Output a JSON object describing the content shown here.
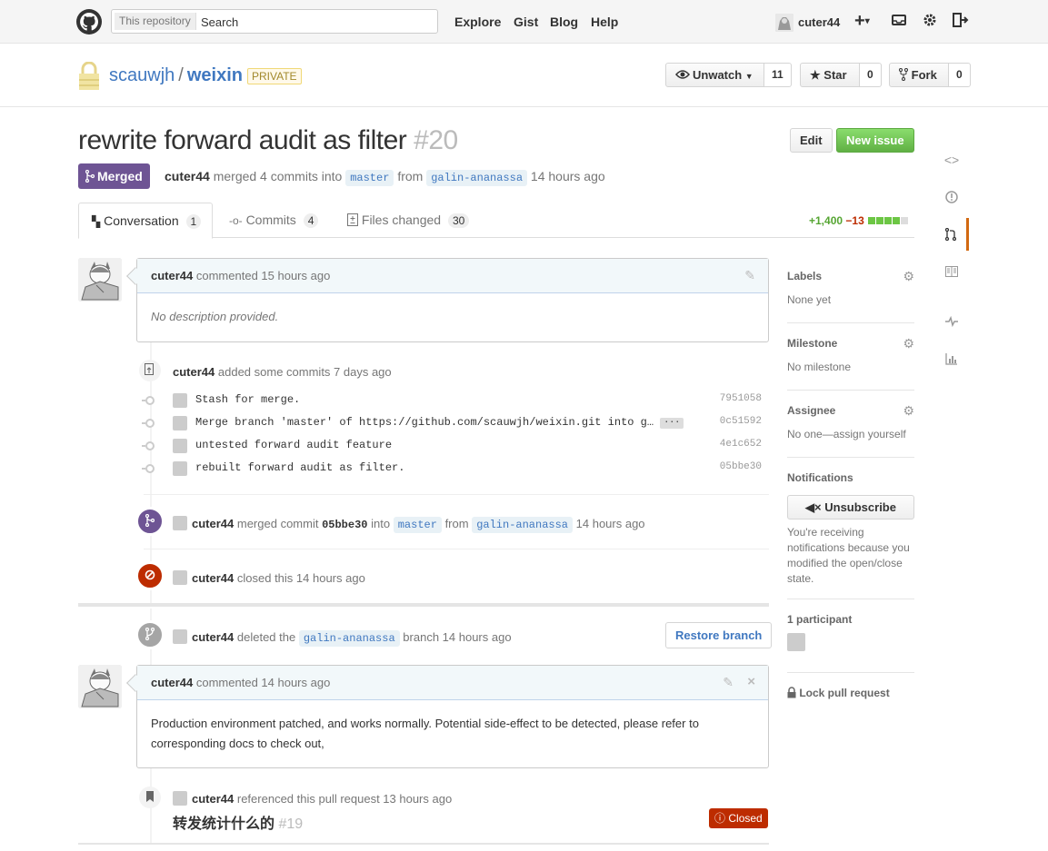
{
  "header": {
    "search_scope": "This repository",
    "search_placeholder": "Search",
    "nav": [
      "Explore",
      "Gist",
      "Blog",
      "Help"
    ],
    "username": "cuter44"
  },
  "repo": {
    "owner": "scauwjh",
    "name": "weixin",
    "visibility": "PRIVATE",
    "unwatch_label": "Unwatch",
    "watch_count": "11",
    "star_label": "Star",
    "star_count": "0",
    "fork_label": "Fork",
    "fork_count": "0"
  },
  "pr": {
    "title": "rewrite forward audit as filter",
    "number": "#20",
    "edit_label": "Edit",
    "new_issue_label": "New issue",
    "state": "Merged",
    "author": "cuter44",
    "merged_text": "merged 4 commits into",
    "base": "master",
    "from_text": "from",
    "head": "galin-ananassa",
    "time": "14 hours ago"
  },
  "tabs": [
    {
      "label": "Conversation",
      "count": "1"
    },
    {
      "label": "Commits",
      "count": "4"
    },
    {
      "label": "Files changed",
      "count": "30"
    }
  ],
  "diffstat": {
    "additions": "+1,400",
    "deletions": "−13"
  },
  "comment1": {
    "author": "cuter44",
    "action": "commented 15 hours ago",
    "body": "No description provided."
  },
  "commits_event": {
    "author": "cuter44",
    "action": "added some commits 7 days ago",
    "commits": [
      {
        "msg": "Stash for merge.",
        "sha": "7951058"
      },
      {
        "msg": "Merge branch 'master' of https://github.com/scauwjh/weixin.git into g…",
        "sha": "0c51592"
      },
      {
        "msg": "untested forward audit feature",
        "sha": "4e1c652"
      },
      {
        "msg": "rebuilt forward audit as filter.",
        "sha": "05bbe30"
      }
    ]
  },
  "merged_event": {
    "author": "cuter44",
    "text1": "merged commit",
    "sha": "05bbe30",
    "text2": "into",
    "base": "master",
    "text3": "from",
    "head": "galin-ananassa",
    "time": "14 hours ago"
  },
  "closed_event": {
    "author": "cuter44",
    "text": "closed this 14 hours ago"
  },
  "deleted_event": {
    "author": "cuter44",
    "text1": "deleted the",
    "branch": "galin-ananassa",
    "text2": "branch 14 hours ago",
    "restore_label": "Restore branch"
  },
  "comment2": {
    "author": "cuter44",
    "action": "commented 14 hours ago",
    "body": "Production environment patched, and works normally. Potential side-effect to be detected, please refer to corresponding docs to check out,"
  },
  "ref_event": {
    "author": "cuter44",
    "text": "referenced this pull request 13 hours ago",
    "issue_title": "转发统计什么的",
    "issue_number": "#19",
    "issue_state": "Closed"
  },
  "sidebar": {
    "labels_title": "Labels",
    "labels_value": "None yet",
    "milestone_title": "Milestone",
    "milestone_value": "No milestone",
    "assignee_title": "Assignee",
    "assignee_value": "No one—assign yourself",
    "notifications_title": "Notifications",
    "unsubscribe_label": "Unsubscribe",
    "notifications_reason": "You're receiving notifications because you modified the open/close state.",
    "participants": "1 participant",
    "lock_label": "Lock pull request"
  },
  "colors": {
    "merged": "#6e5494",
    "closed": "#bd2c00",
    "link": "#4078c0",
    "green": "#60b044"
  }
}
